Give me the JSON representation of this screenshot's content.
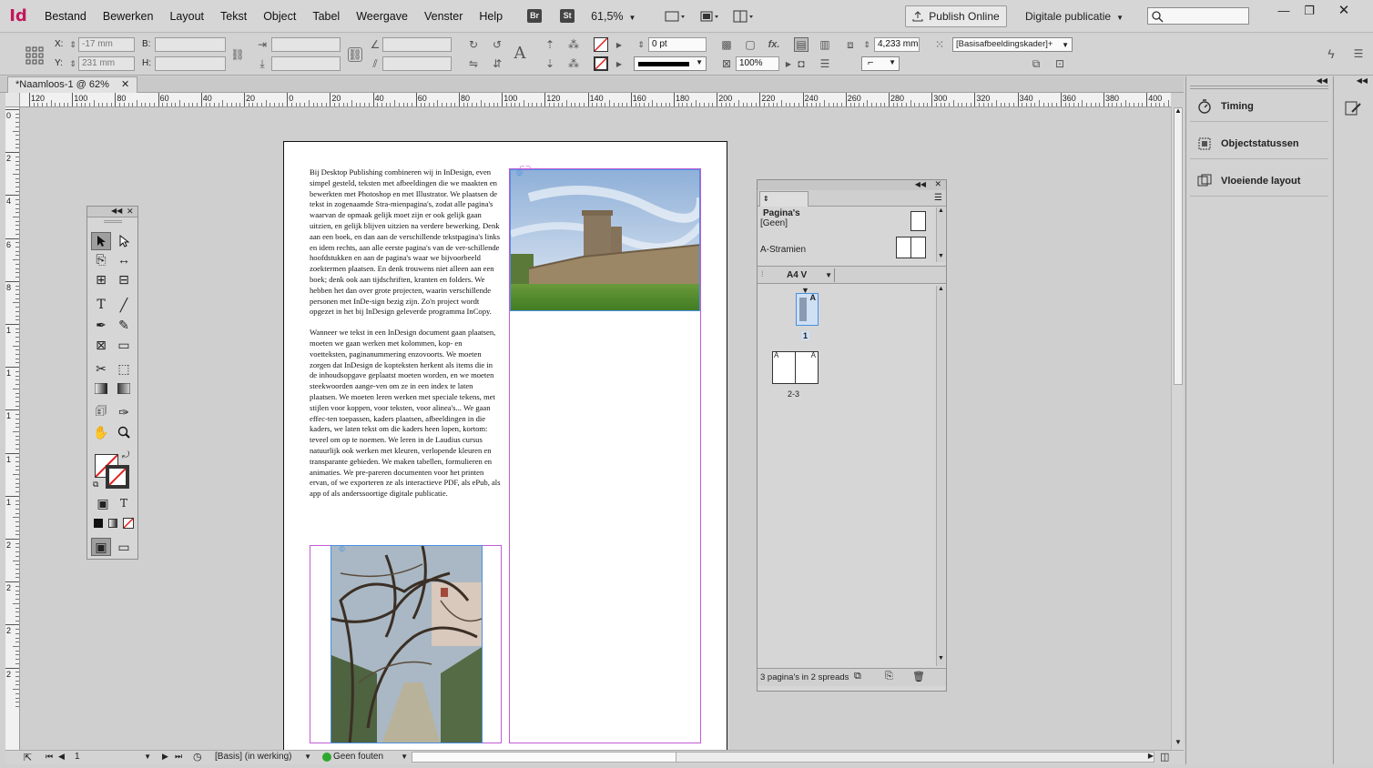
{
  "app": {
    "logo": "Id",
    "menu": [
      "Bestand",
      "Bewerken",
      "Layout",
      "Tekst",
      "Object",
      "Tabel",
      "Weergave",
      "Venster",
      "Help"
    ],
    "bridge_label": "Br",
    "stock_label": "St",
    "zoom": "61,5%",
    "publish_label": "Publish Online",
    "workspace": "Digitale publicatie",
    "search_placeholder": ""
  },
  "control": {
    "x_label": "X:",
    "x_value": "-17 mm",
    "y_label": "Y:",
    "y_value": "231 mm",
    "w_label": "B:",
    "h_label": "H:",
    "stroke_weight": "0 pt",
    "opacity": "100%",
    "fit_value": "4,233 mm",
    "object_style": "[Basisafbeeldingskader]+",
    "fx_label": "fx."
  },
  "document": {
    "tab_title": "*Naamloos-1 @ 62%",
    "ruler_h_labels": [
      "120",
      "100",
      "80",
      "60",
      "40",
      "20",
      "0",
      "20",
      "40",
      "60",
      "80",
      "100",
      "120",
      "140",
      "160",
      "180",
      "200",
      "220",
      "240",
      "260",
      "280",
      "300",
      "320",
      "340",
      "360",
      "380",
      "400"
    ],
    "ruler_v_labels": [
      "0",
      "2",
      "4",
      "6",
      "8",
      "1",
      "1",
      "1",
      "1",
      "1",
      "2",
      "2",
      "2",
      "2"
    ],
    "text_p1": "Bij Desktop Publishing combineren wij in InDesign, even simpel gesteld, teksten met afbeeldingen die we maakten en bewerkten met Photoshop en met Illustrator. We plaatsen de tekst in zogenaamde Stra-mienpagina's, zodat alle pagina's waarvan de opmaak gelijk moet zijn er ook gelijk gaan uitzien, en gelijk blijven uitzien na verdere bewerking. Denk aan een boek, en dan aan de verschillende tekstpagina's links en idem rechts, aan alle eerste pagina's van de ver-schillende hoofdstukken en aan de pagina's waar we bijvoorbeeld zoektermen plaatsen. En denk trouwens niet alleen aan een boek; denk ook aan tijdschriften, kranten en folders. We hebben het dan over grote projecten, waarin verschillende personen met InDe-sign bezig zijn. Zo'n project wordt opgezet in het bij InDesign geleverde programma InCopy.",
    "text_p2": "Wanneer we tekst in een InDesign document gaan plaatsen, moeten we gaan werken met kolommen, kop- en voetteksten, paginanummering enzovoorts. We moeten zorgen dat InDesign de kopteksten herkent als items die in de inhoudsopgave geplaatst moeten worden, en we moeten steekwoorden aange-ven om ze in een index te laten plaatsen. We moeten leren werken met speciale tekens, met stijlen voor koppen, voor teksten, voor alinea's... We gaan effec-ten toepassen, kaders plaatsen, afbeeldingen in die kaders, we laten tekst om die kaders heen lopen, kortom: teveel om op te noemen. We leren in de Laudius cursus natuurlijk ook werken met kleuren, verlopende kleuren en transparante gebieden. We maken tabellen, formulieren en animaties. We pre-pareren documenten voor het printen ervan, of we exporteren ze als interactieve PDF, als ePub, als app of als anderssoortige digitale publicatie."
  },
  "status": {
    "page_number": "1",
    "profile": "[Basis] (in werking)",
    "preflight": "Geen fouten"
  },
  "dock": {
    "items": [
      "Timing",
      "Objectstatussen",
      "Vloeiende layout"
    ]
  },
  "pages_panel": {
    "title": "Pagina's",
    "none_label": "[Geen]",
    "master_label": "A-Stramien",
    "page_size": "A4 V",
    "page1_label": "1",
    "spread2_label": "2-3",
    "master_letter": "A",
    "footer": "3 pagina's in 2 spreads"
  },
  "colors": {
    "guide": "#c25bd6",
    "logo": "#c2185b",
    "frame_blue": "#4a90e2"
  }
}
